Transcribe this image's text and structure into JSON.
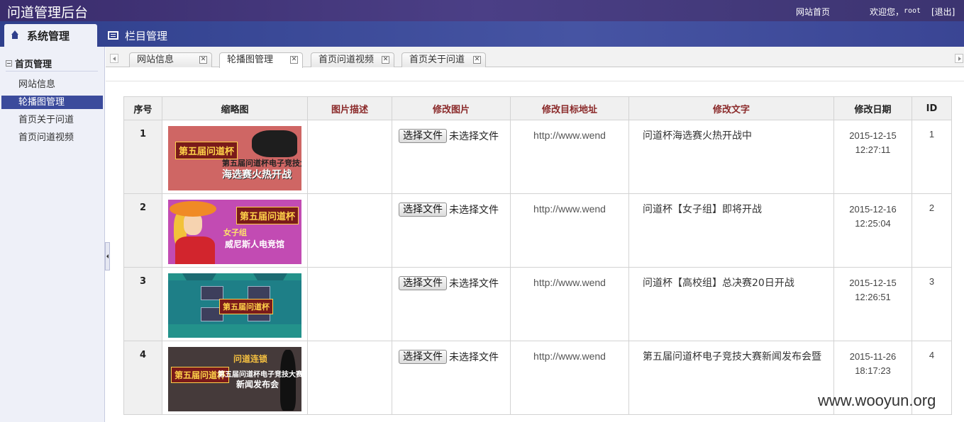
{
  "header": {
    "app_title": "问道管理后台",
    "home_link": "网站首页",
    "welcome": "欢迎您，",
    "user": "root",
    "logout": "[退出]"
  },
  "menu": {
    "system": "系统管理",
    "columns": "栏目管理"
  },
  "sidebar": {
    "section_title": "首页管理",
    "items": [
      {
        "label": "网站信息"
      },
      {
        "label": "轮播图管理"
      },
      {
        "label": "首页关于问道"
      },
      {
        "label": "首页问道视频"
      }
    ]
  },
  "tabs": [
    {
      "label": "网站信息"
    },
    {
      "label": "轮播图管理"
    },
    {
      "label": "首页问道视频"
    },
    {
      "label": "首页关于问道"
    }
  ],
  "table": {
    "headers": [
      "序号",
      "缩略图",
      "图片描述",
      "修改图片",
      "修改目标地址",
      "修改文字",
      "修改日期",
      "ID"
    ],
    "file_button": "选择文件",
    "file_none": "未选择文件",
    "rows": [
      {
        "no": "1",
        "url": "http://www.wend",
        "text": "问道杯海选赛火热开战中",
        "date": "2015-12-15",
        "time": "12:27:11",
        "id": "1",
        "img_logo": "第五届问道杯",
        "img_line1": "第五届问道杯电子竞技大赛",
        "img_line2": "海选赛火热开战"
      },
      {
        "no": "2",
        "url": "http://www.wend",
        "text": "问道杯【女子组】即将开战",
        "date": "2015-12-16",
        "time": "12:25:04",
        "id": "2",
        "img_logo": "第五届问道杯",
        "img_line1": "女子组",
        "img_line2": "威尼斯人电竞馆"
      },
      {
        "no": "3",
        "url": "http://www.wend",
        "text": "问道杯【高校组】总决赛20日开战",
        "date": "2015-12-15",
        "time": "12:26:51",
        "id": "3",
        "img_logo": "第五届问道杯"
      },
      {
        "no": "4",
        "url": "http://www.wend",
        "text": "第五届问道杯电子竞技大赛新闻发布会暨",
        "date": "2015-11-26",
        "time": "18:17:23",
        "id": "4",
        "img_logo": "第五届问道杯",
        "img_line0": "问道连锁",
        "img_line1": "第五届问道杯电子竞技大赛启动",
        "img_line2": "新闻发布会"
      }
    ]
  },
  "watermark": "www.wooyun.org"
}
